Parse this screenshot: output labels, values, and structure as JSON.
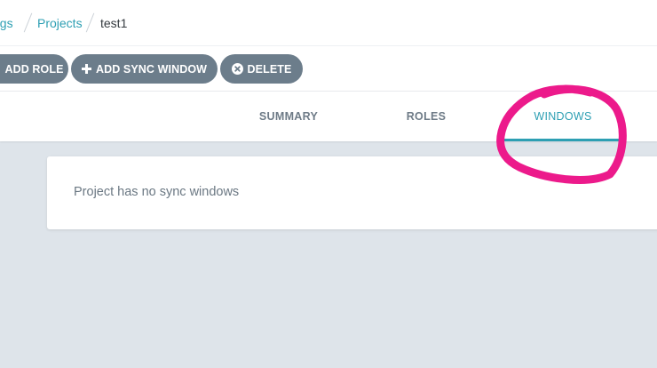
{
  "breadcrumb": {
    "settings": "ngs",
    "projects": "Projects",
    "current": "test1"
  },
  "toolbar": {
    "add_role_label": "ADD ROLE",
    "add_sync_window_label": "ADD SYNC WINDOW",
    "delete_label": "DELETE"
  },
  "tabs": [
    {
      "label": "SUMMARY",
      "active": false
    },
    {
      "label": "ROLES",
      "active": false
    },
    {
      "label": "WINDOWS",
      "active": true
    }
  ],
  "content": {
    "empty_message": "Project has no sync windows"
  },
  "icons": {
    "add_sync_window": "plus-icon",
    "delete": "x-circle-icon"
  },
  "colors": {
    "accent": "#2d9fb3",
    "button": "#6c7d8b",
    "background": "#dee4ea",
    "annotation": "#ec1a8b"
  }
}
